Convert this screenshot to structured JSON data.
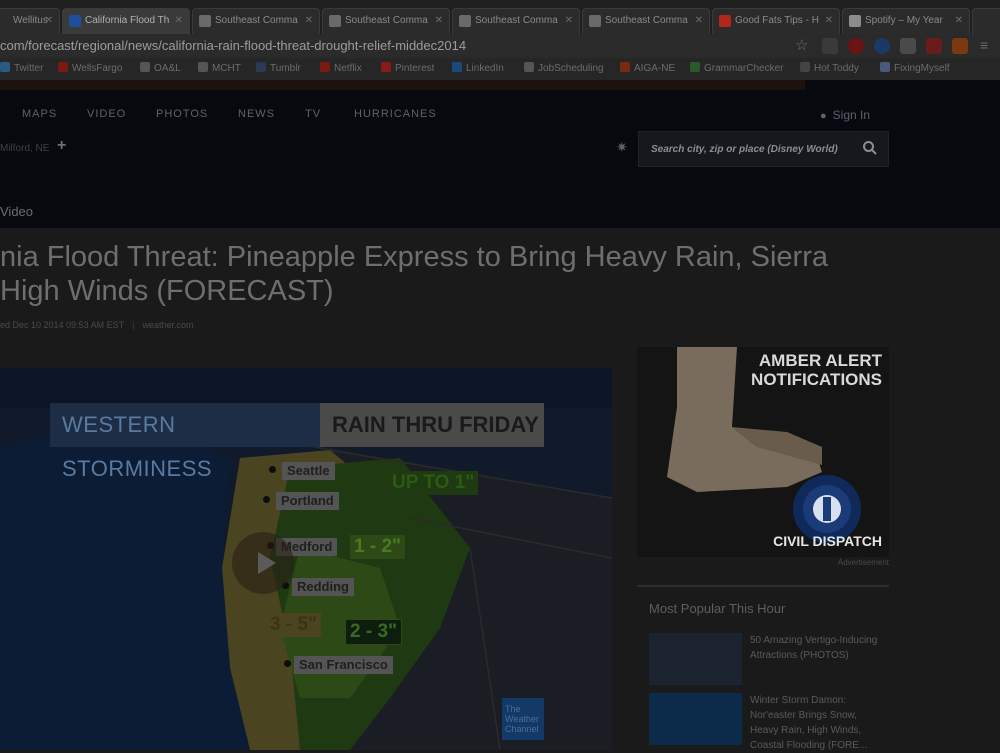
{
  "tabs": [
    {
      "label": "Wellitus",
      "fav_color": "#6a6a6a"
    },
    {
      "label": "California Flood Th",
      "fav_color": "#1d4f9a"
    },
    {
      "label": "Southeast Comma",
      "fav_color": "#777777"
    },
    {
      "label": "Southeast Comma",
      "fav_color": "#777777"
    },
    {
      "label": "Southeast Comma",
      "fav_color": "#777777"
    },
    {
      "label": "Southeast Comma",
      "fav_color": "#777777"
    },
    {
      "label": "Good Fats Tips - H",
      "fav_color": "#b3261e"
    },
    {
      "label": "Spotify – My Year",
      "fav_color": "#8c8c8c"
    }
  ],
  "address": {
    "url": "com/forecast/regional/news/california-rain-flood-threat-drought-relief-middec2014"
  },
  "bookmarks": [
    {
      "label": "Twitter",
      "color": "#2b5a80"
    },
    {
      "label": "WellsFargo",
      "color": "#7a1a12"
    },
    {
      "label": "OA&L",
      "color": "#555555"
    },
    {
      "label": "MCHT",
      "color": "#555555"
    },
    {
      "label": "Tumblr",
      "color": "#2a3a55"
    },
    {
      "label": "Netflix",
      "color": "#7a1a12"
    },
    {
      "label": "Pinterest",
      "color": "#8a1a1a"
    },
    {
      "label": "LinkedIn",
      "color": "#1a4a7a"
    },
    {
      "label": "JobScheduling",
      "color": "#555555"
    },
    {
      "label": "AIGA-NE",
      "color": "#7a2a10"
    },
    {
      "label": "GrammarChecker",
      "color": "#2a5a2a"
    },
    {
      "label": "Hot Toddy",
      "color": "#444444"
    },
    {
      "label": "FixingMyself",
      "color": "#4a5a7a"
    }
  ],
  "nav": {
    "items": [
      "MAPS",
      "VIDEO",
      "PHOTOS",
      "NEWS",
      "TV",
      "HURRICANES"
    ],
    "signin": "Sign In",
    "location": "Milford, NE",
    "breadcrumb": "Video"
  },
  "search": {
    "placeholder": "Search city, zip or place (Disney World)"
  },
  "article": {
    "headline": "nia Flood Threat: Pineapple Express to Bring Heavy Rain, Sierra High Winds (FORECAST)",
    "published": "ed Dec 10 2014 09:53 AM EST",
    "source": "weather.com"
  },
  "video": {
    "banner_left": "WESTERN STORMINESS",
    "banner_right": "RAIN THRU FRIDAY",
    "cities": [
      "Seattle",
      "Portland",
      "Medford",
      "Redding",
      "San Francisco"
    ],
    "amounts": [
      "UP TO 1\"",
      "1 - 2\"",
      "3 - 5\"",
      "2 - 3\""
    ],
    "logo_text": [
      "The",
      "Weather",
      "Channel"
    ],
    "colors": {
      "coast": "#4a4420",
      "heavy": "#2d4a16",
      "moderate": "#1f3a12",
      "ocean": "#0b1526"
    }
  },
  "ad": {
    "title_line1": "AMBER ALERT",
    "title_line2": "NOTIFICATIONS",
    "brand": "CIVIL DISPATCH",
    "label": "Advertisement"
  },
  "popular": {
    "heading": "Most Popular This Hour",
    "items": [
      {
        "text": "50 Amazing Vertigo-Inducing Attractions (PHOTOS)",
        "thumb_color": "#1c2330"
      },
      {
        "text": "Winter Storm Damon: Nor'easter Brings Snow, Heavy Rain, High Winds, Coastal Flooding (FORE...",
        "thumb_color": "#0c2a4a"
      }
    ]
  }
}
